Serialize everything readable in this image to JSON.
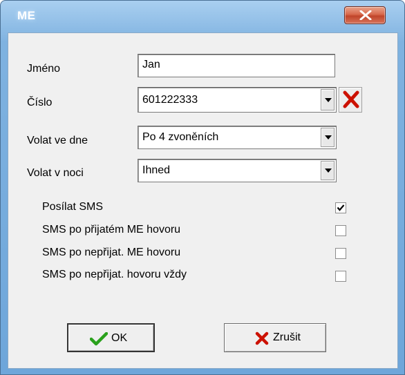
{
  "window": {
    "title": "ME",
    "close_glyph": "X"
  },
  "form": {
    "name": {
      "label": "Jméno",
      "value": "Jan"
    },
    "number": {
      "label": "Číslo",
      "value": "601222333"
    },
    "day_call": {
      "label": "Volat ve dne",
      "selected": "Po 4 zvoněních"
    },
    "night_call": {
      "label": "Volat v noci",
      "selected": "Ihned"
    }
  },
  "options": [
    {
      "label": "Posílat SMS",
      "checked": true
    },
    {
      "label": "SMS po přijatém ME hovoru",
      "checked": false
    },
    {
      "label": "SMS po nepřijat. ME hovoru",
      "checked": false
    },
    {
      "label": "SMS po nepřijat. hovoru vždy",
      "checked": false
    }
  ],
  "buttons": {
    "ok_label": "OK",
    "cancel_label": "Zrušit"
  },
  "icons": {
    "ok": "checkmark-icon",
    "cancel": "red-x-icon",
    "delete": "red-x-icon",
    "dropdown": "chevron-down-icon"
  },
  "colors": {
    "title_bar": "#7fb2e0",
    "close_button": "#c0452a",
    "ok_check": "#2aa11c",
    "delete_red": "#cc1100"
  }
}
